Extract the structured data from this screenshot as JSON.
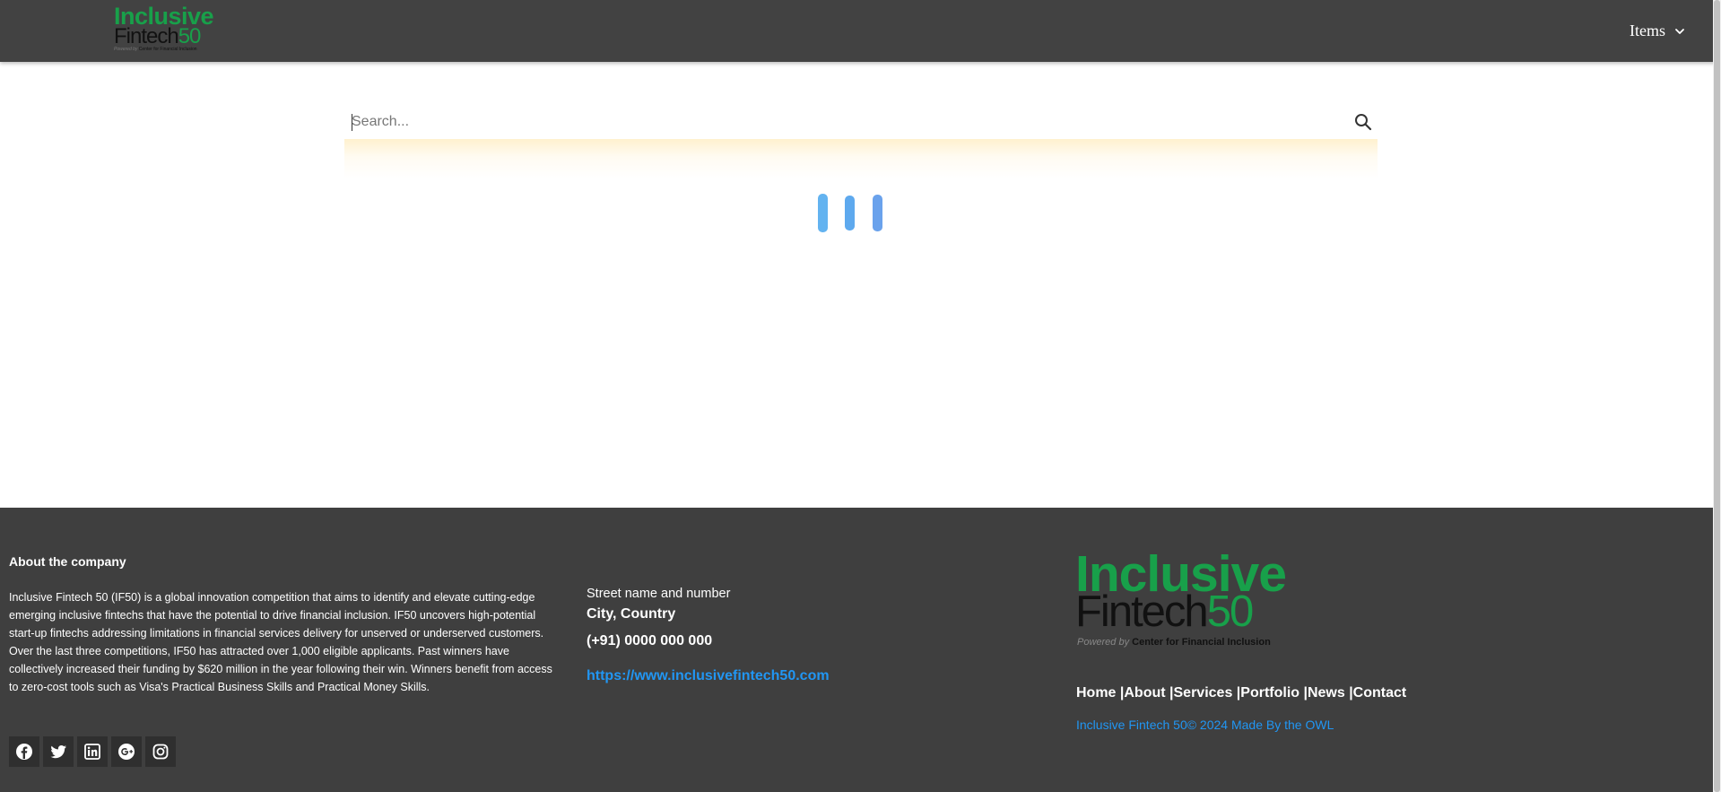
{
  "header": {
    "logo": {
      "line1": "Inclusive",
      "line2_text": "Fintech",
      "line2_num": "50",
      "tagline_prefix": "Powered by",
      "tagline_org": "Center for Financial Inclusion"
    },
    "menu_label": "Items",
    "menu_icon": "chevron-down-icon"
  },
  "search": {
    "placeholder": "Search...",
    "value": "",
    "icon": "search-icon"
  },
  "loader": {
    "bar_count": 3,
    "colors": [
      "#63b3f0",
      "#5ea9ee",
      "#6aa2ec"
    ]
  },
  "footer": {
    "about": {
      "title": "About the company",
      "text": "Inclusive Fintech 50 (IF50) is a global innovation competition that aims to identify and elevate cutting-edge emerging inclusive fintechs that have the potential to drive financial inclusion. IF50 uncovers high-potential start-up fintechs addressing limitations in financial services delivery for unserved or underserved customers. Over the last three competitions, IF50 has attracted over 1,000 eligible applicants. Past winners have collectively increased their funding by $620 million in the year following their win. Winners benefit from access to zero-cost tools such as Visa's Practical Business Skills and Practical Money Skills."
    },
    "socials": [
      "facebook-icon",
      "twitter-icon",
      "linkedin-icon",
      "google-plus-icon",
      "instagram-icon"
    ],
    "contact": {
      "street": "Street name and number",
      "city": "City, Country",
      "phone": "(+91) 0000 000 000",
      "website": "https://www.inclusivefintech50.com"
    },
    "logo": {
      "line1": "Inclusive",
      "line2_text": "Fintech",
      "line2_num": "50",
      "tagline_prefix": "Powered by",
      "tagline_org": "Center for Financial Inclusion"
    },
    "nav": [
      {
        "label": "Home |"
      },
      {
        "label": "About |"
      },
      {
        "label": "Services |"
      },
      {
        "label": "Portfolio |"
      },
      {
        "label": "News |"
      },
      {
        "label": "Contact"
      }
    ],
    "copyright": "Inclusive Fintech 50© 2024 Made By the OWL"
  },
  "colors": {
    "header_bg": "#424242",
    "footer_bg": "#3f3f3f",
    "brand_green": "#18a04a",
    "link_blue": "#2196f3"
  }
}
